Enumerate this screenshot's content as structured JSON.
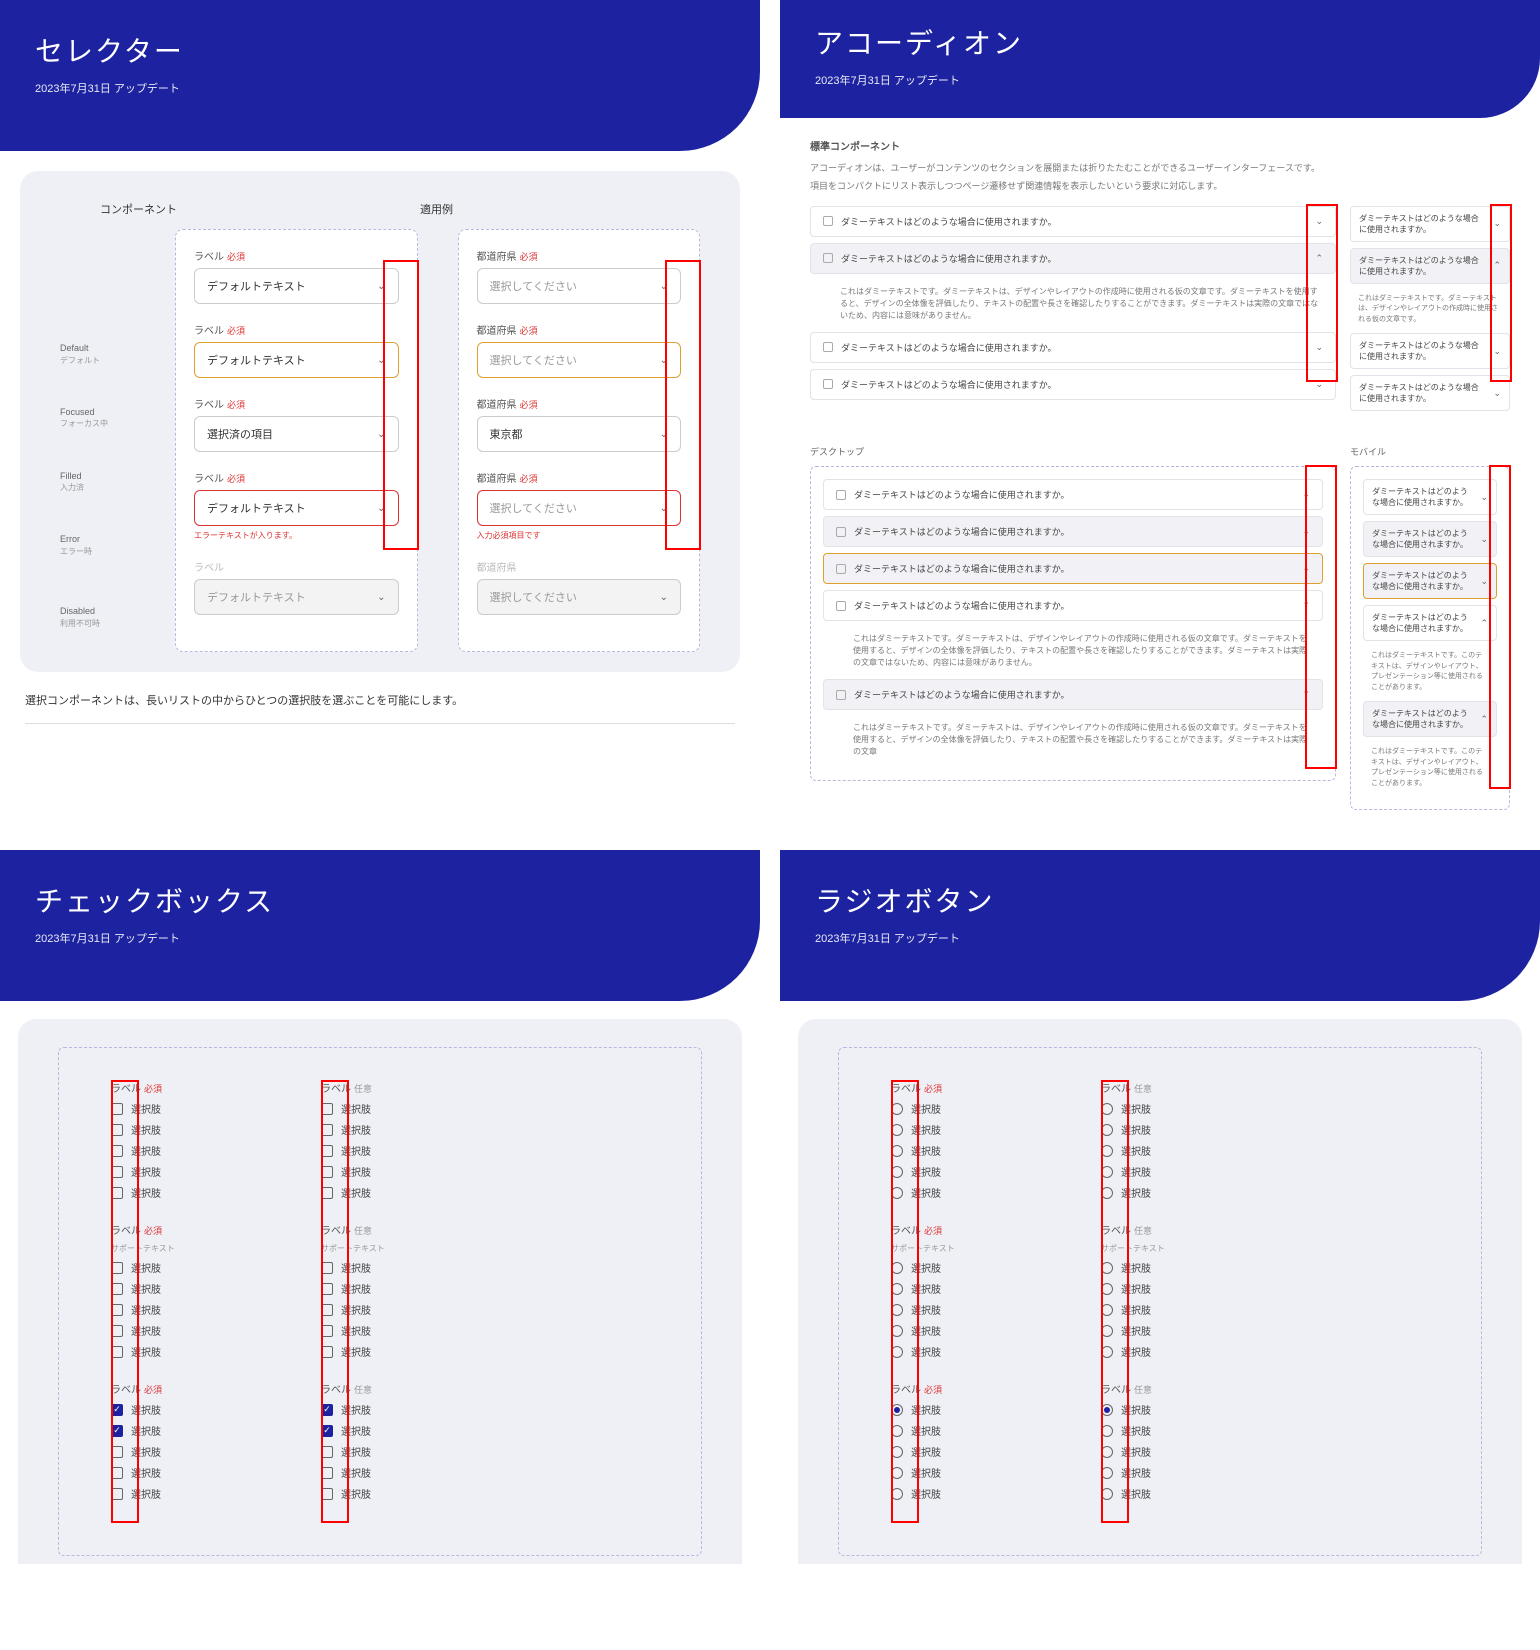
{
  "cards": {
    "selector": {
      "title": "セレクター",
      "date": "2023年7月31日 アップデート"
    },
    "accordion": {
      "title": "アコーディオン",
      "date": "2023年7月31日 アップデート"
    },
    "checkbox": {
      "title": "チェックボックス",
      "date": "2023年7月31日 アップデート"
    },
    "radio": {
      "title": "ラジオボタン",
      "date": "2023年7月31日 アップデート"
    }
  },
  "sel": {
    "colA": "コンポーネント",
    "colB": "適用例",
    "states": {
      "default": {
        "en": "Default",
        "jp": "デフォルト"
      },
      "focused": {
        "en": "Focused",
        "jp": "フォーカス中"
      },
      "filled": {
        "en": "Filled",
        "jp": "入力済"
      },
      "error": {
        "en": "Error",
        "jp": "エラー時"
      },
      "disabled": {
        "en": "Disabled",
        "jp": "利用不可時"
      }
    },
    "labelA": "ラベル",
    "labelB": "都道府県",
    "req": "必須",
    "valA": "デフォルトテキスト",
    "valB": "選択してください",
    "valFilledA": "選択済の項目",
    "valFilledB": "東京都",
    "errA": "エラーテキストが入ります。",
    "errB": "入力必須項目です",
    "desc": "選択コンポーネントは、長いリストの中からひとつの選択肢を選ぶことを可能にします。"
  },
  "acc": {
    "h": "標準コンポーネント",
    "p1": "アコーディオンは、ユーザーがコンテンツのセクションを展開または折りたたむことができるユーザーインターフェースです。",
    "p2": "項目をコンパクトにリスト表示しつつページ遷移せず関連情報を表示したいという要求に対応します。",
    "itemTxt": "ダミーテキストはどのような場合に使用されますか。",
    "body": "これはダミーテキストです。ダミーテキストは、デザインやレイアウトの作成時に使用される仮の文章です。ダミーテキストを使用すると、デザインの全体像を評価したり、テキストの配置や長さを確認したりすることができます。ダミーテキストは実際の文章ではないため、内容には意味がありません。",
    "body2": "これはダミーテキストです。ダミーテキストは、デザインやレイアウトの作成時に使用される仮の文章です。ダミーテキストを使用すると、デザインの全体像を評価したり、テキストの配置や長さを確認したりすることができます。ダミーテキストは実際の文章",
    "bodyM": "これはダミーテキストです。このテキストは、デザインやレイアウト、プレゼンテーション等に使用されることがあります。",
    "bodyM2": "これはダミーテキストです。ダミーテキストは、デザインやレイアウトの作成時に使用される仮の文章です。",
    "desktop": "デスクトップ",
    "mobile": "モバイル"
  },
  "chk": {
    "label": "ラベル",
    "req": "必須",
    "opt": "任意",
    "sup": "サポートテキスト",
    "item": "選択肢"
  }
}
